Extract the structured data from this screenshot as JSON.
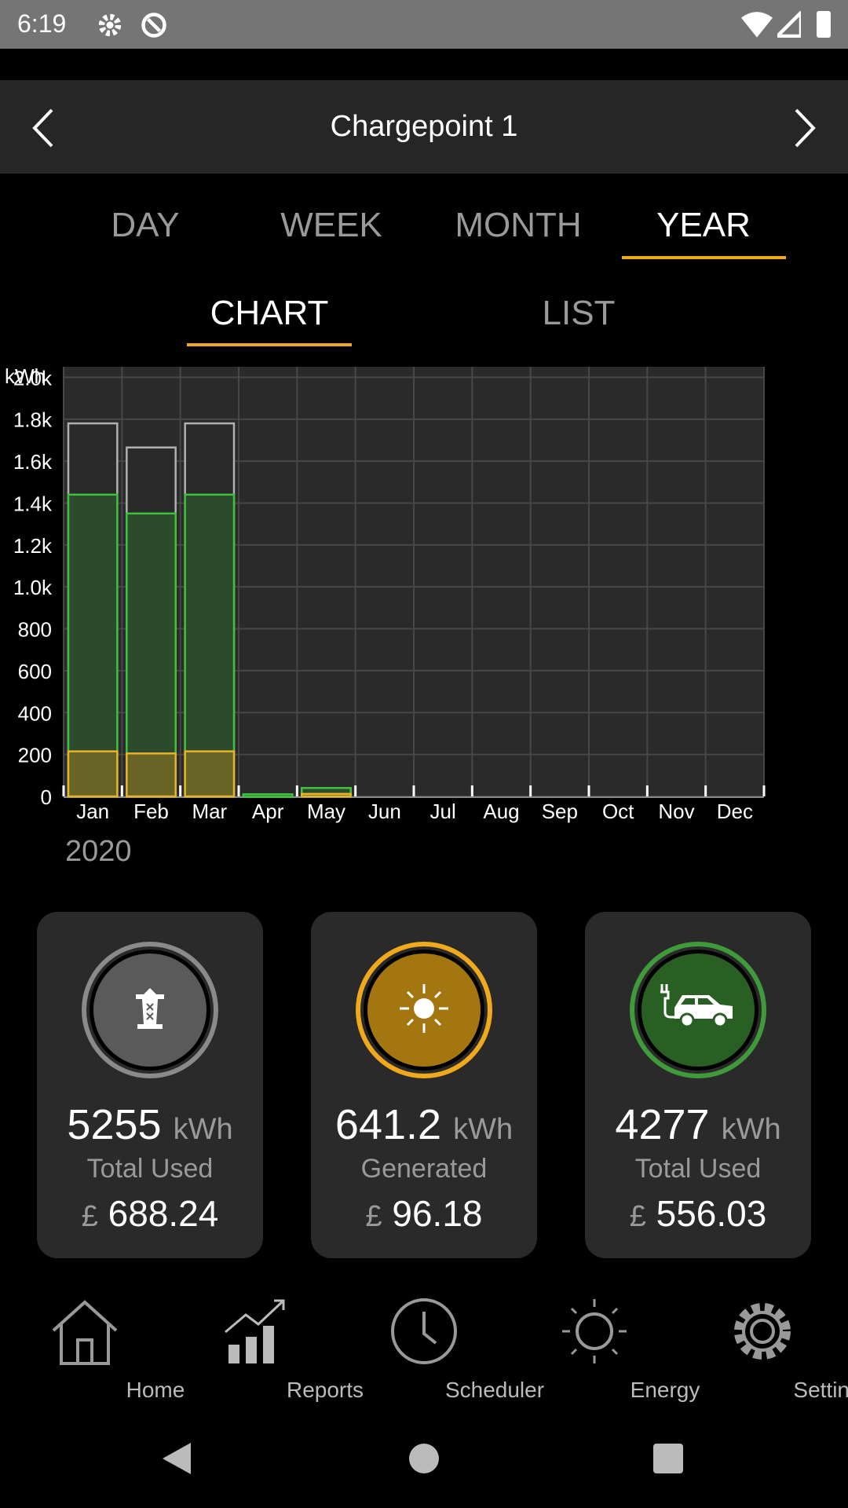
{
  "status_bar": {
    "time": "6:19"
  },
  "header": {
    "title": "Chargepoint 1"
  },
  "period_tabs": [
    {
      "label": "DAY"
    },
    {
      "label": "WEEK"
    },
    {
      "label": "MONTH"
    },
    {
      "label": "YEAR",
      "active": true
    }
  ],
  "view_tabs": [
    {
      "label": "CHART",
      "active": true
    },
    {
      "label": "LIST"
    }
  ],
  "colors": {
    "accent": "#f0a81c",
    "total": "#b0b0b0",
    "ev": "#3cc13c",
    "generated": "#e8b22a"
  },
  "chart_data": {
    "type": "bar",
    "ylabel": "kWh",
    "xlabel": "2020",
    "categories": [
      "Jan",
      "Feb",
      "Mar",
      "Apr",
      "May",
      "Jun",
      "Jul",
      "Aug",
      "Sep",
      "Oct",
      "Nov",
      "Dec"
    ],
    "yticks": [
      "0",
      "200",
      "400",
      "600",
      "800",
      "1.0k",
      "1.2k",
      "1.4k",
      "1.6k",
      "1.8k",
      "2.0k"
    ],
    "ylim": [
      0,
      2050
    ],
    "grid": true,
    "overlapping": true,
    "series": [
      {
        "color": "#b0b0b0",
        "values": [
          1780,
          1665,
          1780,
          10,
          40,
          0,
          0,
          0,
          0,
          0,
          0,
          0
        ]
      },
      {
        "color": "#3cc13c",
        "values": [
          1440,
          1350,
          1440,
          10,
          40,
          0,
          0,
          0,
          0,
          0,
          0,
          0
        ]
      },
      {
        "color": "#e8b22a",
        "values": [
          215,
          205,
          215,
          0,
          12,
          0,
          0,
          0,
          0,
          0,
          0,
          0
        ]
      }
    ]
  },
  "cards": [
    {
      "icon": "pylon-icon",
      "value": "5255",
      "unit": "kWh",
      "label": "Total Used",
      "currency": "£",
      "price": "688.24",
      "ring": "#8a8a8a",
      "fill": "#5a5a5a"
    },
    {
      "icon": "sun-icon",
      "value": "641.2",
      "unit": "kWh",
      "label": "Generated",
      "currency": "£",
      "price": "96.18",
      "ring": "#f0a81c",
      "fill": "#a37610"
    },
    {
      "icon": "ev-car-icon",
      "value": "4277",
      "unit": "kWh",
      "label": "Total Used",
      "currency": "£",
      "price": "556.03",
      "ring": "#3f9a3a",
      "fill": "#2a5f24"
    }
  ],
  "bottom_nav": [
    {
      "label": "Home"
    },
    {
      "label": "Reports"
    },
    {
      "label": "Scheduler"
    },
    {
      "label": "Energy"
    },
    {
      "label": "Settings"
    }
  ]
}
